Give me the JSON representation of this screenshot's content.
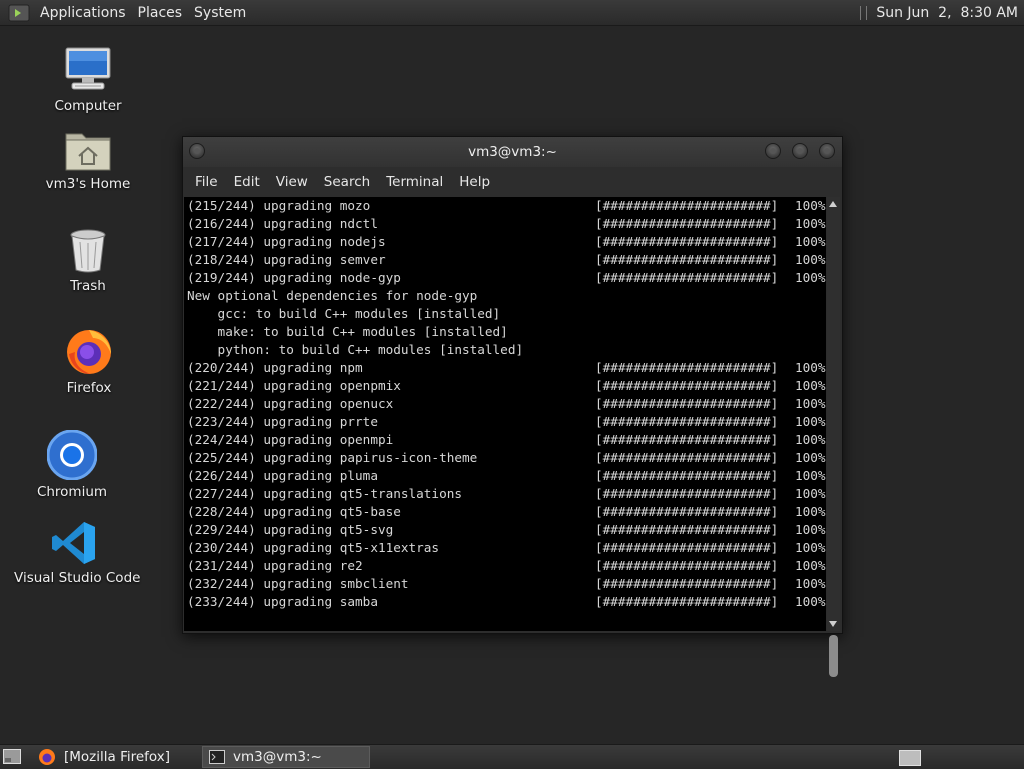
{
  "top_panel": {
    "menus": [
      "Applications",
      "Places",
      "System"
    ],
    "clock": "Sun Jun  2,  8:30 AM"
  },
  "desktop": {
    "icons": [
      {
        "label": "Computer",
        "icon": "computer-icon"
      },
      {
        "label": "vm3's Home",
        "icon": "home-folder-icon"
      },
      {
        "label": "Trash",
        "icon": "trash-icon"
      },
      {
        "label": "Firefox",
        "icon": "firefox-icon"
      },
      {
        "label": "Chromium",
        "icon": "chromium-icon"
      },
      {
        "label": "Visual Studio Code",
        "icon": "vscode-icon"
      }
    ]
  },
  "terminal": {
    "title": "vm3@vm3:~",
    "menu": [
      "File",
      "Edit",
      "View",
      "Search",
      "Terminal",
      "Help"
    ],
    "progress_bar": "[######################]",
    "lines": [
      {
        "text": "(215/244) upgrading mozo",
        "pct": "100%"
      },
      {
        "text": "(216/244) upgrading ndctl",
        "pct": "100%"
      },
      {
        "text": "(217/244) upgrading nodejs",
        "pct": "100%"
      },
      {
        "text": "(218/244) upgrading semver",
        "pct": "100%"
      },
      {
        "text": "(219/244) upgrading node-gyp",
        "pct": "100%"
      },
      {
        "text": "New optional dependencies for node-gyp",
        "pct": ""
      },
      {
        "text": "    gcc: to build C++ modules [installed]",
        "pct": ""
      },
      {
        "text": "    make: to build C++ modules [installed]",
        "pct": ""
      },
      {
        "text": "    python: to build C++ modules [installed]",
        "pct": ""
      },
      {
        "text": "(220/244) upgrading npm",
        "pct": "100%"
      },
      {
        "text": "(221/244) upgrading openpmix",
        "pct": "100%"
      },
      {
        "text": "(222/244) upgrading openucx",
        "pct": "100%"
      },
      {
        "text": "(223/244) upgrading prrte",
        "pct": "100%"
      },
      {
        "text": "(224/244) upgrading openmpi",
        "pct": "100%"
      },
      {
        "text": "(225/244) upgrading papirus-icon-theme",
        "pct": "100%"
      },
      {
        "text": "(226/244) upgrading pluma",
        "pct": "100%"
      },
      {
        "text": "(227/244) upgrading qt5-translations",
        "pct": "100%"
      },
      {
        "text": "(228/244) upgrading qt5-base",
        "pct": "100%"
      },
      {
        "text": "(229/244) upgrading qt5-svg",
        "pct": "100%"
      },
      {
        "text": "(230/244) upgrading qt5-x11extras",
        "pct": "100%"
      },
      {
        "text": "(231/244) upgrading re2",
        "pct": "100%"
      },
      {
        "text": "(232/244) upgrading smbclient",
        "pct": "100%"
      },
      {
        "text": "(233/244) upgrading samba",
        "pct": "100%"
      }
    ]
  },
  "taskbar": {
    "tasks": [
      {
        "label": "[Mozilla Firefox]",
        "active": false
      },
      {
        "label": "vm3@vm3:~",
        "active": true
      }
    ]
  }
}
